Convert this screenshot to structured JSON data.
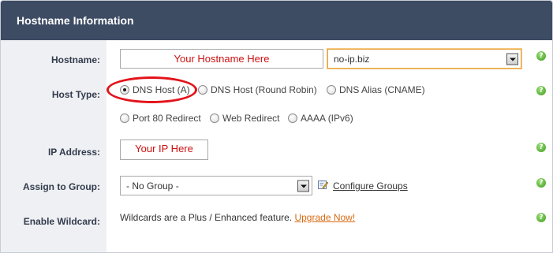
{
  "header": {
    "title": "Hostname Information"
  },
  "rows": {
    "hostname": {
      "label": "Hostname:",
      "input_value": "Your Hostname Here",
      "domain_selected": "no-ip.biz"
    },
    "host_type": {
      "label": "Host Type:",
      "options": [
        {
          "label": "DNS Host (A)",
          "checked": true
        },
        {
          "label": "DNS Host (Round Robin)",
          "checked": false
        },
        {
          "label": "DNS Alias (CNAME)",
          "checked": false
        },
        {
          "label": "Port 80 Redirect",
          "checked": false
        },
        {
          "label": "Web Redirect",
          "checked": false
        },
        {
          "label": "AAAA (IPv6)",
          "checked": false
        }
      ]
    },
    "ip_address": {
      "label": "IP Address:",
      "input_value": "Your IP Here"
    },
    "group": {
      "label": "Assign to Group:",
      "selected": "- No Group -",
      "configure_link": "Configure Groups"
    },
    "wildcard": {
      "label": "Enable Wildcard:",
      "text": "Wildcards are a Plus / Enhanced feature.",
      "upgrade_link": "Upgrade Now!"
    }
  },
  "help_icon_glyph": "?",
  "colors": {
    "header_bg": "#3d4b63",
    "label_bg": "#eef0f3",
    "link": "#d86a12",
    "highlight": "#e3131a",
    "placeholder_text": "#cc1111",
    "help_green": "#3e9a1e"
  }
}
